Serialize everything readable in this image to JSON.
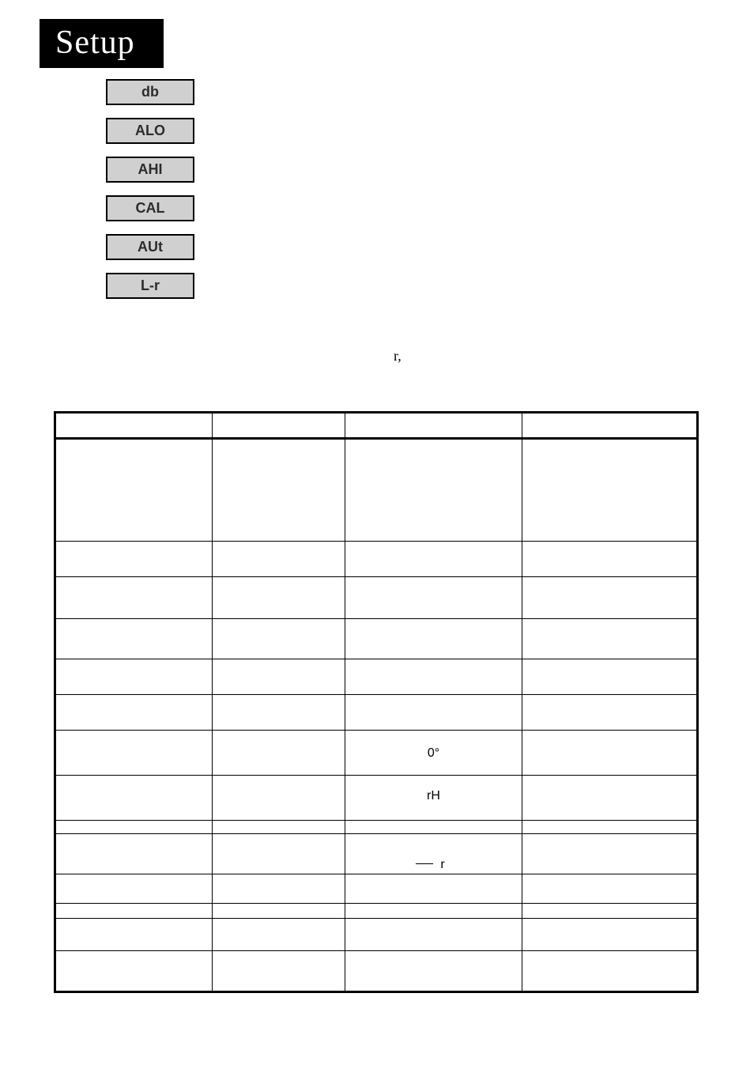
{
  "header": {
    "title": "Setup"
  },
  "menu": {
    "items": [
      "db",
      "ALO",
      "AHI",
      "CAL",
      "AUt",
      "L-r"
    ]
  },
  "stray": {
    "r1": "r,"
  },
  "table": {
    "rows": {
      "q0_col3": "0°",
      "rh_col3": "rH",
      "rsub_col3": "r"
    }
  }
}
